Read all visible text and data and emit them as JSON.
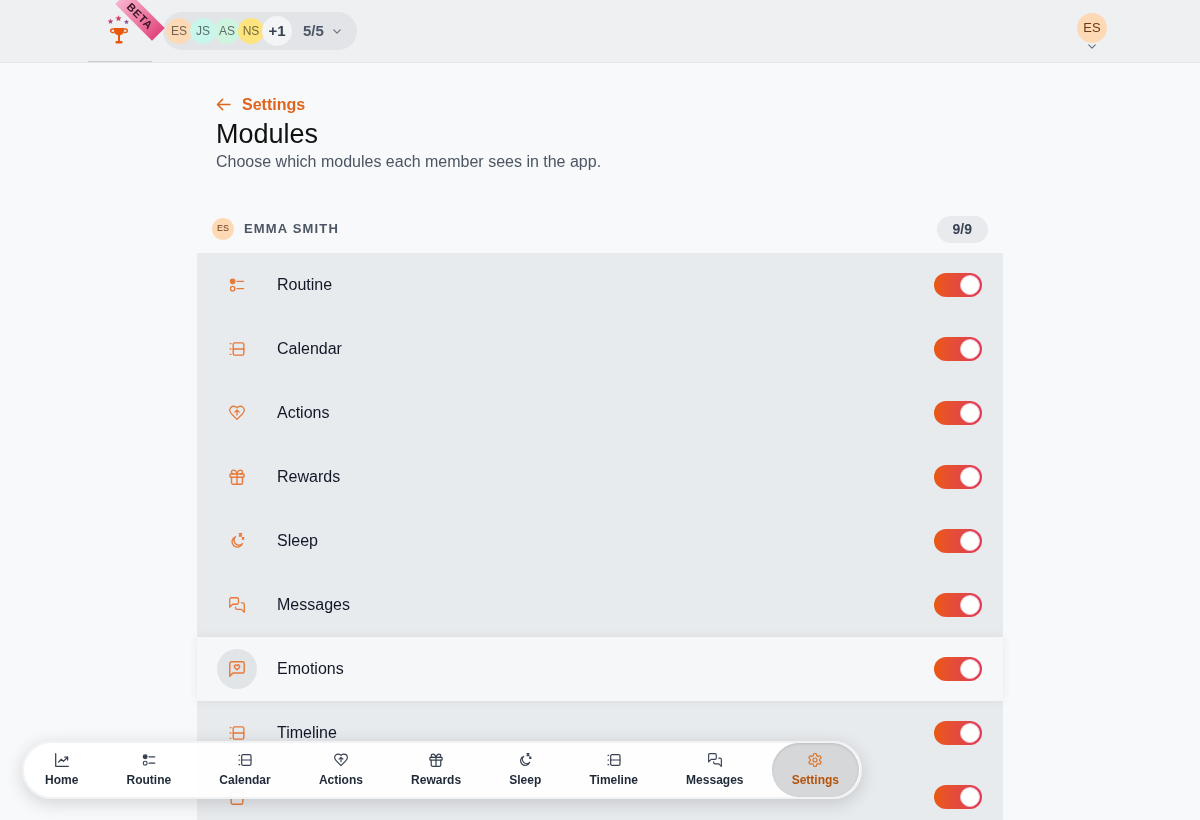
{
  "header": {
    "logo_badge": "BETA",
    "members": [
      {
        "initials": "ES",
        "color": "#fdd9b5"
      },
      {
        "initials": "JS",
        "color": "#c8f5ec"
      },
      {
        "initials": "AS",
        "color": "#cff5e1"
      },
      {
        "initials": "NS",
        "color": "#fde47f"
      }
    ],
    "more_members": "+1",
    "member_count": "5/5",
    "user_avatar": {
      "initials": "ES"
    }
  },
  "back_link": "Settings",
  "title": "Modules",
  "subtitle": "Choose which modules each member sees in the app.",
  "member_section": {
    "avatar": {
      "initials": "ES"
    },
    "name": "EMMA SMITH",
    "enabled_count": "9/9",
    "modules": [
      {
        "kind": "routine",
        "label": "Routine",
        "on": true,
        "highlighted": false
      },
      {
        "kind": "calendar",
        "label": "Calendar",
        "on": true,
        "highlighted": false
      },
      {
        "kind": "actions",
        "label": "Actions",
        "on": true,
        "highlighted": false
      },
      {
        "kind": "rewards",
        "label": "Rewards",
        "on": true,
        "highlighted": false
      },
      {
        "kind": "sleep",
        "label": "Sleep",
        "on": true,
        "highlighted": false
      },
      {
        "kind": "messages",
        "label": "Messages",
        "on": true,
        "highlighted": false
      },
      {
        "kind": "emotions",
        "label": "Emotions",
        "on": true,
        "highlighted": true
      },
      {
        "kind": "timeline",
        "label": "Timeline",
        "on": true,
        "highlighted": false
      },
      {
        "kind": "questionnaires",
        "on": true,
        "highlighted": false
      }
    ]
  },
  "bottom_nav": [
    {
      "kind": "home",
      "label": "Home",
      "selected": false
    },
    {
      "kind": "routine",
      "label": "Routine",
      "selected": false
    },
    {
      "kind": "calendar",
      "label": "Calendar",
      "selected": false
    },
    {
      "kind": "actions",
      "label": "Actions",
      "selected": false
    },
    {
      "kind": "rewards",
      "label": "Rewards",
      "selected": false
    },
    {
      "kind": "sleep",
      "label": "Sleep",
      "selected": false
    },
    {
      "kind": "timeline",
      "label": "Timeline",
      "selected": false
    },
    {
      "kind": "messages",
      "label": "Messages",
      "selected": false
    },
    {
      "kind": "settings",
      "label": "Settings",
      "selected": true
    }
  ]
}
